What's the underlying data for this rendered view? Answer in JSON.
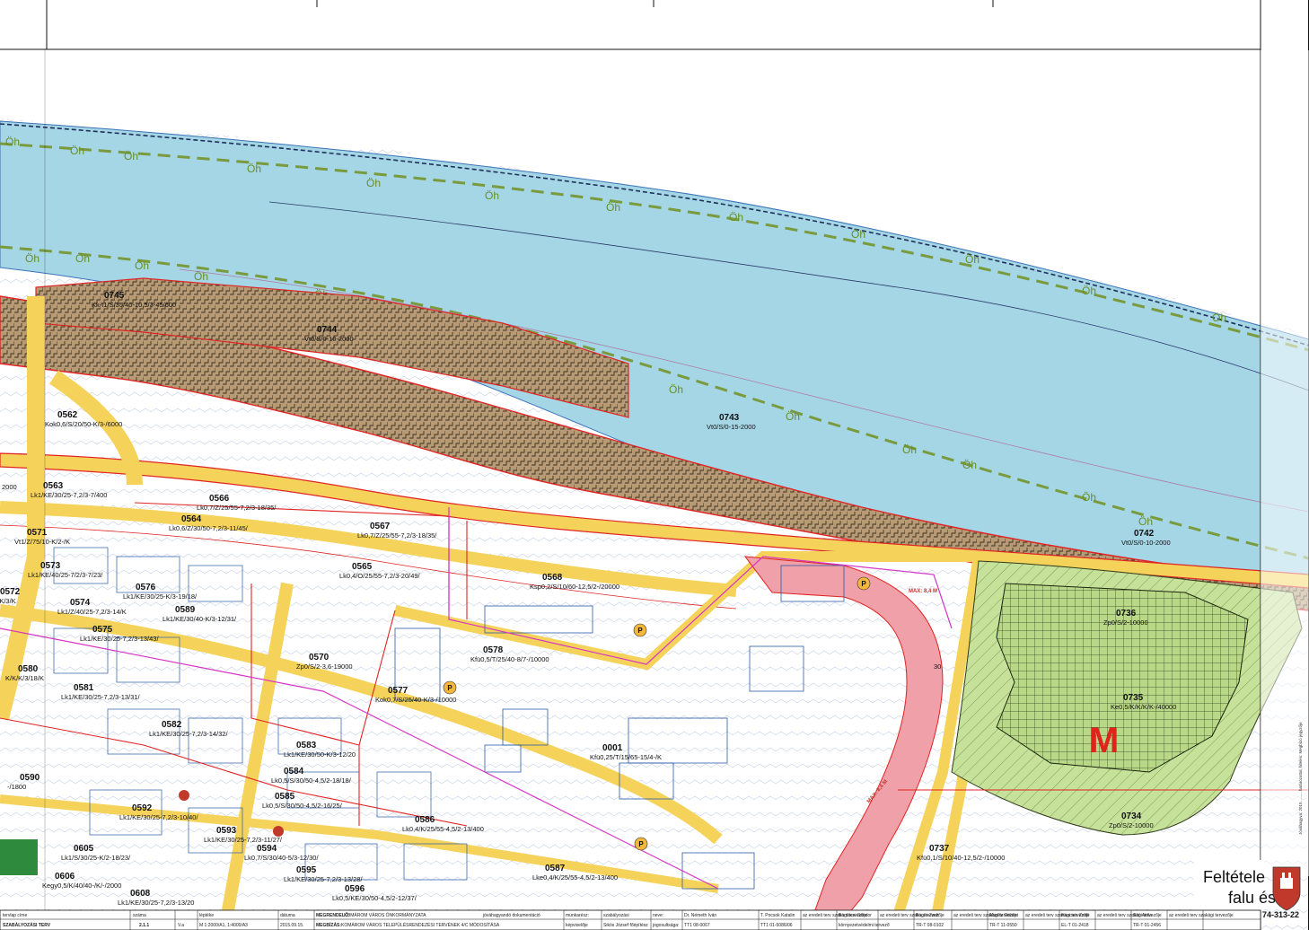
{
  "map": {
    "river_label": "Öh",
    "parcels": [
      {
        "id": "0745",
        "code": "Kk-t1/S/35/40-10,5/3-45/600"
      },
      {
        "id": "0744",
        "code": "Vt0/S/0-10-2000"
      },
      {
        "id": "0743",
        "code": "Vt0/S/0-15-2000"
      },
      {
        "id": "0742",
        "code": "Vt0/S/0-10-2000"
      },
      {
        "id": "0562",
        "code": "Kok0,6/S/20/50-K/3-/6000"
      },
      {
        "id": "0563",
        "code": "Lk1/KE/30/25-7,2/3-7/400"
      },
      {
        "id": "0566",
        "code": "Lk0,7/Z/25/55-7,2/3-18/35/"
      },
      {
        "id": "0564",
        "code": "Lk0,6/Z/30/50-7,2/3-11/45/"
      },
      {
        "id": "0567",
        "code": "Lk0,7/Z/25/55-7,2/3-18/35/"
      },
      {
        "id": "0565",
        "code": "Lk0,4/O/25/55-7,2/3-20/49/"
      },
      {
        "id": "0568",
        "code": "Ksp0,2/S/10/60-12,5/2-/20000"
      },
      {
        "id": "0571",
        "code": "Vt1/Z/75/10-K/2-/K"
      },
      {
        "id": "0573",
        "code": "Lk1/KE/40/25-7/2/3-7/23/"
      },
      {
        "id": "0576",
        "code": "Lk1/KE/30/25-K/3-19/18/"
      },
      {
        "id": "0572",
        "code": "-16-K/3/K"
      },
      {
        "id": "0574",
        "code": "Lk1/Z/40/25-7,2/3-14/K"
      },
      {
        "id": "0589",
        "code": "Lk1/KE/30/40-K/3-12/31/"
      },
      {
        "id": "0575",
        "code": "Lk1/KE/30/25-7,2/3-13/43/"
      },
      {
        "id": "0570",
        "code": "Zp0/S/2-3,6-19000"
      },
      {
        "id": "0578",
        "code": "Kfü0,5/T/25/40-8/7-/10000"
      },
      {
        "id": "0577",
        "code": "Kok0,7/S/25/40-K/3-/10000"
      },
      {
        "id": "0580",
        "code": "K/K/K/3/18/K"
      },
      {
        "id": "0581",
        "code": "Lk1/KE/30/25-7,2/3-13/31/"
      },
      {
        "id": "0582",
        "code": "Lk1/KE/30/25-7,2/3-14/32/"
      },
      {
        "id": "0583",
        "code": "Lk1/KE/30/50-K/3-12/20"
      },
      {
        "id": "0584",
        "code": "Lk0,5/S/30/50-4,5/2-18/18/"
      },
      {
        "id": "0585",
        "code": "Lk0,5/S/30/50-4,5/2-16/25/"
      },
      {
        "id": "0586",
        "code": "Lk0,4/K/25/55-4,5/2-13/400"
      },
      {
        "id": "0587",
        "code": "Lke0,4/K/25/55-4,5/2-13/400"
      },
      {
        "id": "0590",
        "code": "-/1800"
      },
      {
        "id": "0592",
        "code": "Lk1/KE/30/25-7,2/3-10/40/"
      },
      {
        "id": "0593",
        "code": "Lk1/KE/30/25-7,2/3-11/27/"
      },
      {
        "id": "0594",
        "code": "Lk0,7/S/30/40-5/3-12/30/"
      },
      {
        "id": "0595",
        "code": "Lk1/KE/30/25-7,2/3-13/28/"
      },
      {
        "id": "0596",
        "code": "Lk0,5/KE/30/50-4,5/2-12/37/"
      },
      {
        "id": "0605",
        "code": "Lk1/S/30/25-K/2-18/23/"
      },
      {
        "id": "0606",
        "code": "Kegy0,5/K/40/40-/K/-/2000"
      },
      {
        "id": "0608",
        "code": "Lk1/KE/30/25-7,2/3-13/20"
      },
      {
        "id": "0001",
        "code": "Kfü0,25/T/15/65-15/4-/K"
      },
      {
        "id": "0736",
        "code": "Zp0/S/2-10000"
      },
      {
        "id": "0735",
        "code": "Ke0,5/K/K/K/K-/40000"
      },
      {
        "id": "0734",
        "code": "Zp0/S/2-10000"
      },
      {
        "id": "0737",
        "code": "Kfü0,1/S/10/40-12,5/2-/10000"
      }
    ],
    "max_height_labels": [
      "MAX: 8,4 M",
      "MAX: 8,4 M"
    ],
    "zone_letter": "M",
    "contour_value": "30",
    "frame_marker": "2000"
  },
  "sidebar": {
    "doc_number": "74-313-22",
    "note": "Jóváhagyva: 2015. ....... határozattal, hiteles: Megbízó jegyzője"
  },
  "banner": {
    "line1": "Feltétele",
    "line2": "falu és"
  },
  "title_block": {
    "tervlap_cime_label": "tervlap címe",
    "szam_label": "száma",
    "lepteke_label": "léptéke",
    "datuma_label": "dátuma",
    "sheet_title": "SZABÁLYOZÁSI TERV",
    "sheet_number": "2.1.1",
    "version": "V.a",
    "scale": "M 1:2000/A1, 1:4000/A3",
    "date": "2015.09.15.",
    "megrendelo_label": "MEGRENDELŐ:",
    "megrendelo": "KOMÁROM VÁROS ÖNKORMÁNYZATA",
    "megbizas_label": "MEGBÍZÁS:",
    "megbizas": "KOMÁROM VÁROS TELEPÜLÉSRENDEZÉSI TERVÉNEK 4/C MÓDOSÍTÁSA",
    "fazis_label": "fázis:",
    "fazis": "jóváhagyandó dokumentáció",
    "munkareszt_label": "munkarész:",
    "munkareszt": "szabályozási",
    "kepviselo_label": "képviselője",
    "kepviselo": "Sikós József főépítész",
    "nev_label": "neve:",
    "jogosultsag_label": "jogosultsága:",
    "team": [
      {
        "name": "Dr. Németh Iván",
        "role": "vezető tervező",
        "num": "TT1 08-0067"
      },
      {
        "name": "T. Pocsok Katalin",
        "role": "tájtervező",
        "num": "TT1 01-5086/06"
      },
      {
        "name": "Bordócsi Sándor",
        "role": "környezetvédelmi tervező",
        "num": "az eredeti terv szakági tervezője"
      },
      {
        "name": "Bogár Zsolt",
        "role": "útszakértő",
        "num": "TR-T 08-0102"
      },
      {
        "name": "Muslitz Róbert",
        "role": "közlekedési tervező",
        "num": "TR-T 11-0550"
      },
      {
        "name": "Hancsár Zsolt",
        "role": "közműtervező",
        "num": "EL-T 01-2418"
      },
      {
        "name": "Sitó Attila",
        "role": "közműtervező",
        "num": "TR-T 01-2456"
      }
    ],
    "original_designer": "az eredeti terv szakági tervezője"
  }
}
